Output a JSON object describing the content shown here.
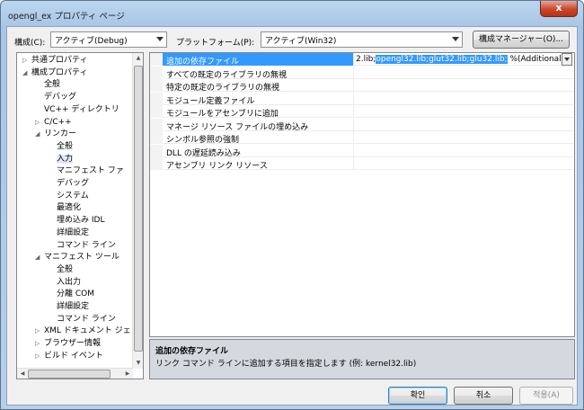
{
  "window": {
    "title": "opengl_ex プロパティ ページ",
    "close_glyph": "x"
  },
  "toolbar": {
    "config_label": "構成(C):",
    "config_value": "アクティブ(Debug)",
    "platform_label": "プラットフォーム(P):",
    "platform_value": "アクティブ(Win32)",
    "config_manager": "構成マネージャー(O)..."
  },
  "tree": {
    "items": [
      {
        "label": "共通プロパティ",
        "toggle": "▷"
      },
      {
        "label": "構成プロパティ",
        "toggle": "◢"
      },
      {
        "label": "全般",
        "toggle": ""
      },
      {
        "label": "デバッグ",
        "toggle": ""
      },
      {
        "label": "VC++ ディレクトリ",
        "toggle": ""
      },
      {
        "label": "C/C++",
        "toggle": "▷"
      },
      {
        "label": "リンカー",
        "toggle": "◢"
      },
      {
        "label": "全般",
        "toggle": ""
      },
      {
        "label": "入力",
        "toggle": ""
      },
      {
        "label": "マニフェスト ファ",
        "toggle": ""
      },
      {
        "label": "デバッグ",
        "toggle": ""
      },
      {
        "label": "システム",
        "toggle": ""
      },
      {
        "label": "最適化",
        "toggle": ""
      },
      {
        "label": "埋め込み IDL",
        "toggle": ""
      },
      {
        "label": "詳細設定",
        "toggle": ""
      },
      {
        "label": "コマンド ライン",
        "toggle": ""
      },
      {
        "label": "マニフェスト ツール",
        "toggle": "◢"
      },
      {
        "label": "全般",
        "toggle": ""
      },
      {
        "label": "入出力",
        "toggle": ""
      },
      {
        "label": "分離 COM",
        "toggle": ""
      },
      {
        "label": "詳細設定",
        "toggle": ""
      },
      {
        "label": "コマンド ライン",
        "toggle": ""
      },
      {
        "label": "XML ドキュメント ジェ",
        "toggle": "▷"
      },
      {
        "label": "ブラウザー情報",
        "toggle": "▷"
      },
      {
        "label": "ビルド イベント",
        "toggle": "▷"
      }
    ]
  },
  "grid": {
    "rows": [
      {
        "name": "追加の依存ファイル"
      },
      {
        "name": "すべての既定のライブラリの無視"
      },
      {
        "name": "特定の既定のライブラリの無視"
      },
      {
        "name": "モジュール定義ファイル"
      },
      {
        "name": "モジュールをアセンブリに追加"
      },
      {
        "name": "マネージ リソース ファイルの埋め込み"
      },
      {
        "name": "シンボル参照の強制"
      },
      {
        "name": "DLL の遅延読み込み"
      },
      {
        "name": "アセンブリ リンク リソース"
      }
    ],
    "edit_prefix": "2.lib;",
    "edit_selected": "opengl32.lib;glut32.lib;glu32.lib;",
    "edit_suffix": "%(AdditionalD"
  },
  "description": {
    "title": "追加の依存ファイル",
    "text": "リンク コマンド ラインに追加する項目を指定します (例: kernel32.lib)"
  },
  "buttons": {
    "ok": "확인",
    "cancel": "취소",
    "apply": "적용(A)"
  }
}
